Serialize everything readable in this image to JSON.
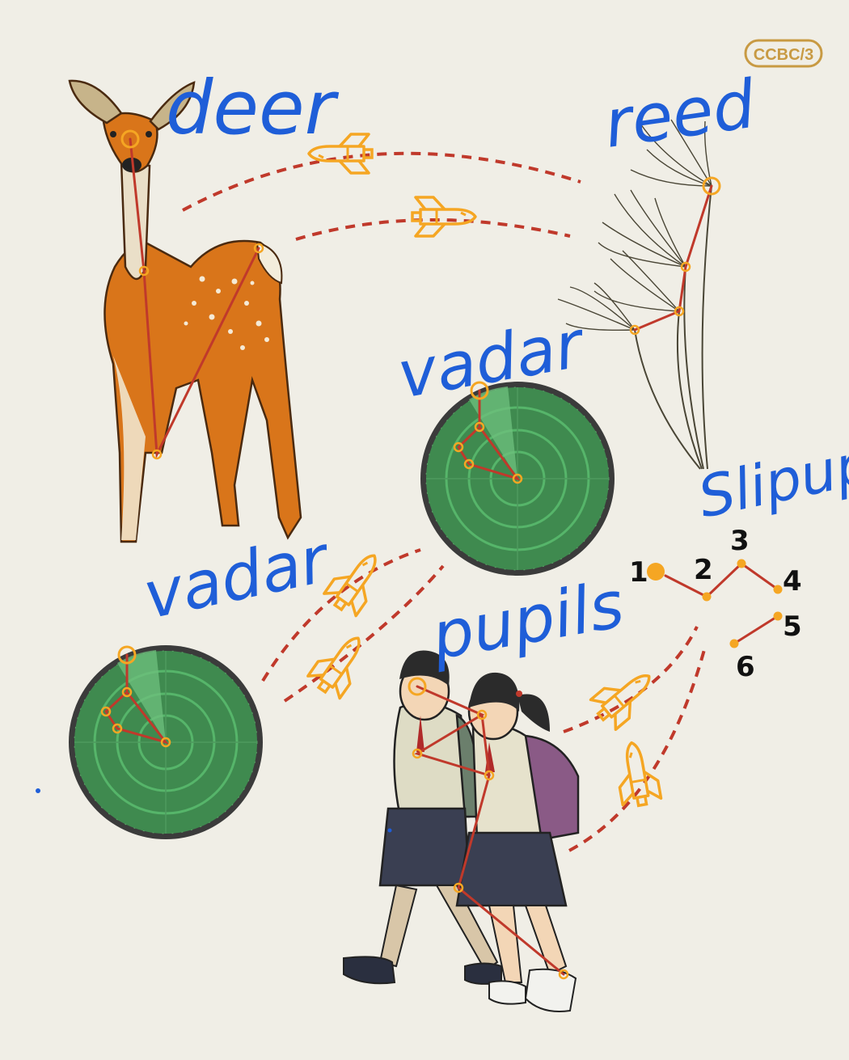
{
  "logo": {
    "text": "CCBC/3"
  },
  "labels": {
    "deer": "deer",
    "reed": "reed",
    "radar_top": "vadar",
    "radar_left": "vadar",
    "pupils": "pupils",
    "slipup": "Slipup"
  },
  "slipup_points": [
    "1",
    "2",
    "3",
    "4",
    "5",
    "6"
  ],
  "colors": {
    "background": "#f0eee6",
    "handwriting": "#1f5ed8",
    "connector": "#c0392b",
    "marker": "#f5a623",
    "radar_fill": "#3f8a4f",
    "radar_rim": "#4a4a4a",
    "deer_coat": "#d9751a"
  },
  "icons": {
    "shuttle": "space-shuttle-icon",
    "marker": "ring-marker-icon"
  }
}
